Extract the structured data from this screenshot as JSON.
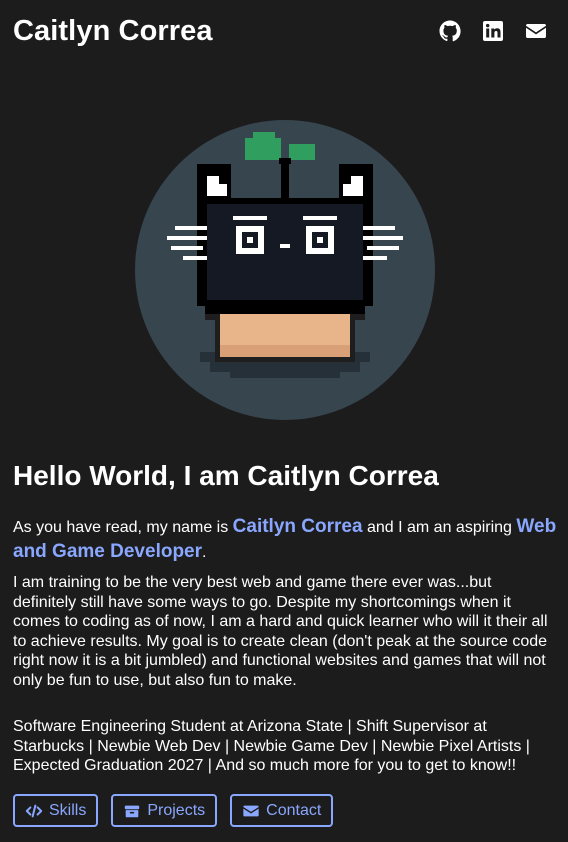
{
  "header": {
    "title": "Caitlyn Correa",
    "social": [
      {
        "icon": "github-icon"
      },
      {
        "icon": "linkedin-icon"
      },
      {
        "icon": "envelope-icon"
      }
    ]
  },
  "avatar": {
    "background": "#37454e",
    "icon": "pixel-cat-in-flowerpot"
  },
  "intro": {
    "heading": "Hello World, I am Caitlyn Correa",
    "p1_before": "As you have read, my name is ",
    "p1_name": "Caitlyn Correa",
    "p1_middle": " and I am an aspiring ",
    "p1_role": "Web and Game Developer",
    "p1_after": ".",
    "p2": "I am training to be the very best web and game there ever was...but definitely still have some ways to go. Despite my shortcomings when it comes to coding as of now, I am a hard and quick learner who will it their all to achieve results. My goal is to create clean (don't peak at the source code right now it is a bit jumbled) and functional websites and games that will not only be fun to use, but also fun to make.",
    "p3": "Software Engineering Student at Arizona State | Shift Supervisor at Starbucks | Newbie Web Dev | Newbie Game Dev | Newbie Pixel Artists | Expected Graduation 2027 | And so much more for you to get to know!!"
  },
  "buttons": [
    {
      "label": "Skills",
      "icon": "code-icon"
    },
    {
      "label": "Projects",
      "icon": "archive-icon"
    },
    {
      "label": "Contact",
      "icon": "envelope-icon"
    }
  ],
  "colors": {
    "background": "#1c1c1c",
    "accent": "#8aa7ff",
    "text": "#ffffff"
  }
}
